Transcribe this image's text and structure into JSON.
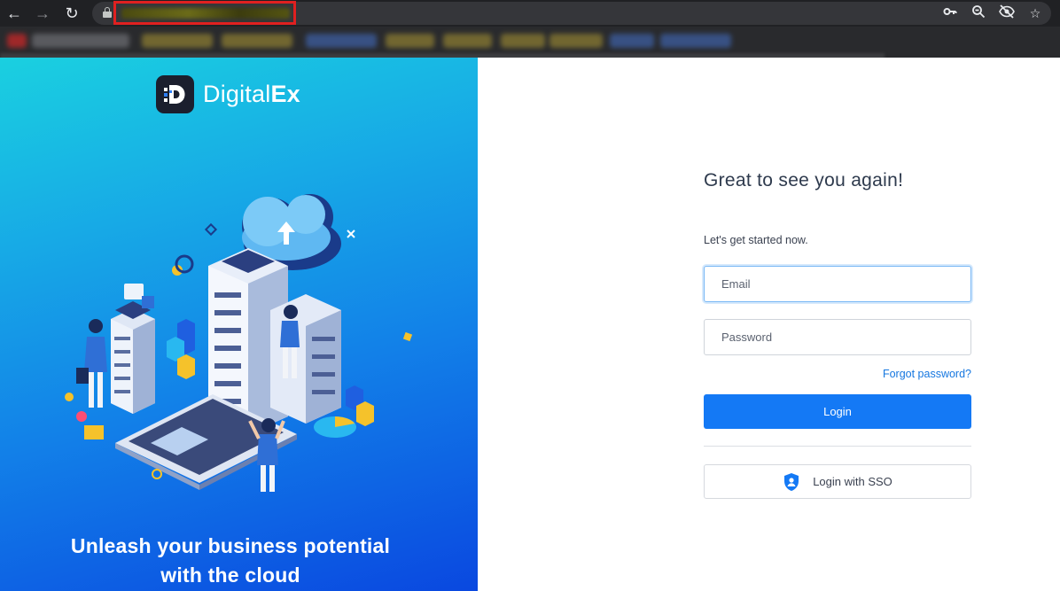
{
  "browser": {
    "back_icon": "arrow-left-icon",
    "forward_icon": "arrow-right-icon",
    "reload_icon": "reload-icon",
    "lock_icon": "lock-icon",
    "right_icons": [
      "key-icon",
      "zoom-icon",
      "eye-off-icon",
      "star-icon"
    ],
    "redact_color": "#e02020"
  },
  "brand": {
    "name_light": "Digital",
    "name_bold": "Ex"
  },
  "hero": {
    "tagline_line1": "Unleash your business potential",
    "tagline_line2": "with the cloud"
  },
  "login": {
    "heading": "Great to see you again!",
    "subheading": "Let's get started now.",
    "email_placeholder": "Email",
    "password_placeholder": "Password",
    "forgot_label": "Forgot password?",
    "login_label": "Login",
    "sso_label": "Login with SSO",
    "accent": "#1479f5"
  }
}
